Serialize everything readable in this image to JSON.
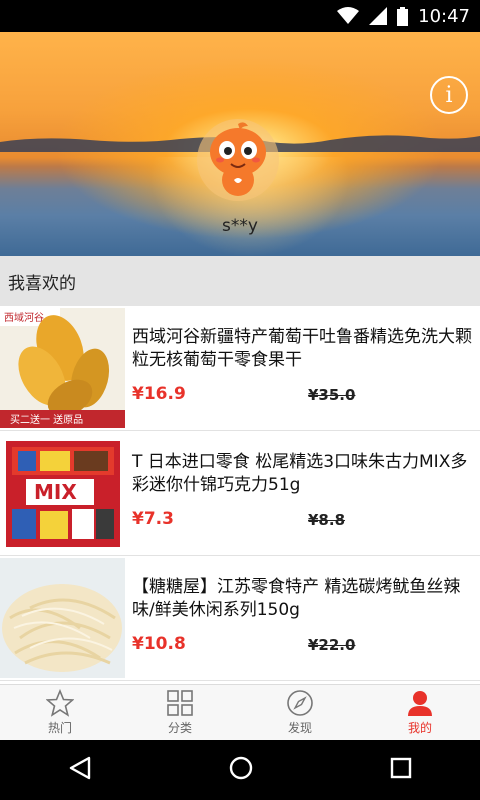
{
  "status_bar": {
    "time": "10:47"
  },
  "profile": {
    "username": "s**y"
  },
  "section": {
    "title": "我喜欢的"
  },
  "products": [
    {
      "title": "西域河谷新疆特产葡萄干吐鲁番精选免洗大颗粒无核葡萄干零食果干",
      "price": "¥16.9",
      "original_price": "¥35.0",
      "thumb_brand": "西域河谷",
      "thumb_banner": "买二送一  送原品"
    },
    {
      "title": "T 日本进口零食 松尾精选3口味朱古力MIX多彩迷你什锦巧克力51g",
      "price": "¥7.3",
      "original_price": "¥8.8"
    },
    {
      "title": "【糖糖屋】江苏零食特产 精选碳烤鱿鱼丝辣味/鲜美休闲系列150g",
      "price": "¥10.8",
      "original_price": "¥22.0"
    }
  ],
  "tabs": [
    {
      "label": "热门",
      "icon": "star-icon"
    },
    {
      "label": "分类",
      "icon": "grid-icon"
    },
    {
      "label": "发现",
      "icon": "compass-icon"
    },
    {
      "label": "我的",
      "icon": "person-icon"
    }
  ],
  "colors": {
    "accent": "#e8322a",
    "section_bg": "#e4e4e4"
  }
}
